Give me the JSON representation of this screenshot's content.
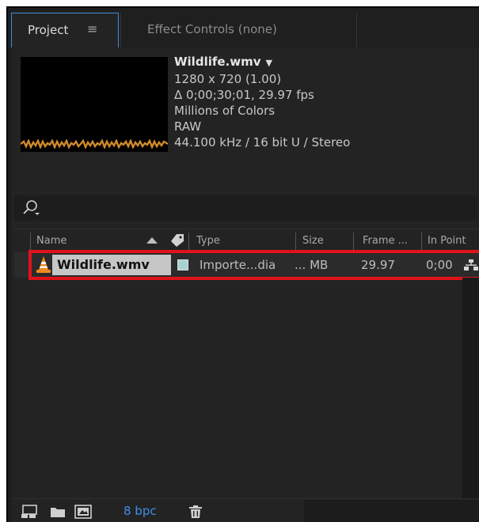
{
  "tabs": {
    "project_label": "Project",
    "menu_glyph": "≡",
    "effect_controls_label": "Effect Controls (none)"
  },
  "preview": {
    "filename": "Wildlife.wmv",
    "caret": "▼",
    "resolution": "1280 x 720 (1.00)",
    "duration": "Δ 0;00;30;01, 29.97 fps",
    "colors": "Millions of Colors",
    "codec": "RAW",
    "audio": "44.100 kHz / 16 bit U / Stereo",
    "waveform_color": "#d08a2a"
  },
  "search": {
    "icon": "search-icon"
  },
  "columns": {
    "name": "Name",
    "type": "Type",
    "size": "Size",
    "frame": "Frame ...",
    "in_point": "In Point"
  },
  "rows": [
    {
      "name": "Wildlife.wmv",
      "icon": "vlc-cone-icon",
      "label_color": "#a9d3d0",
      "type": "Importe...dia",
      "size": "... MB",
      "frame_rate": "29.97",
      "in_point": "0;00"
    }
  ],
  "bottom": {
    "bpc_label": "8 bpc",
    "accent": "#3f8ee6"
  },
  "highlight_color": "#e2121a"
}
